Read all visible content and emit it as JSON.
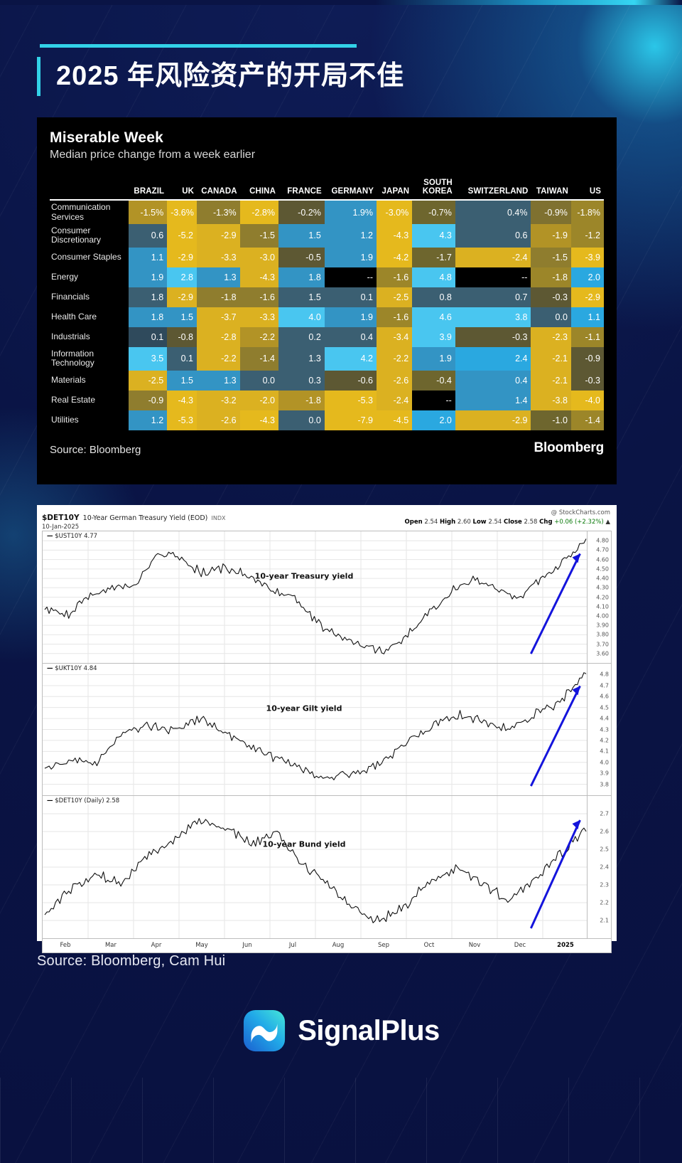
{
  "header": {
    "title": "2025 年风险资产的开局不佳"
  },
  "bloomberg": {
    "title": "Miserable Week",
    "subtitle": "Median price change from a week earlier",
    "source": "Source: Bloomberg",
    "logo": "Bloomberg",
    "columns": [
      "BRAZIL",
      "UK",
      "CANADA",
      "CHINA",
      "FRANCE",
      "GERMANY",
      "JAPAN",
      "SOUTH KOREA",
      "SWITZERLAND",
      "TAIWAN",
      "US"
    ],
    "rows": [
      {
        "label": "Communication Services",
        "values": [
          "-1.5%",
          "-3.6%",
          "-1.3%",
          "-2.8%",
          "-0.2%",
          "1.9%",
          "-3.0%",
          "-0.7%",
          "0.4%",
          "-0.9%",
          "-1.8%"
        ],
        "colors": [
          "#b29326",
          "#e5b91d",
          "#8f7d2e",
          "#e5b91d",
          "#5d5833",
          "#3394c4",
          "#e5b91d",
          "#6e662e",
          "#3b5f72",
          "#7f7130",
          "#9c8629"
        ]
      },
      {
        "label": "Consumer Discretionary",
        "values": [
          "0.6",
          "-5.2",
          "-2.9",
          "-1.5",
          "1.5",
          "1.2",
          "-4.3",
          "4.3",
          "0.6",
          "-1.9",
          "-1.2"
        ],
        "colors": [
          "#3b5f72",
          "#e5b91d",
          "#dbb121",
          "#8f7d2e",
          "#3394c4",
          "#3394c4",
          "#e5b91d",
          "#49c6f0",
          "#3b5f72",
          "#b29326",
          "#9c8629"
        ]
      },
      {
        "label": "Consumer Staples",
        "values": [
          "1.1",
          "-2.9",
          "-3.3",
          "-3.0",
          "-0.5",
          "1.9",
          "-4.2",
          "-1.7",
          "-2.4",
          "-1.5",
          "-3.9"
        ],
        "colors": [
          "#3394c4",
          "#e5b91d",
          "#dbb121",
          "#dbb121",
          "#5d5833",
          "#3394c4",
          "#e5b91d",
          "#6e662e",
          "#dbb121",
          "#8f7d2e",
          "#e5b91d"
        ]
      },
      {
        "label": "Energy",
        "values": [
          "1.9",
          "2.8",
          "1.3",
          "-4.3",
          "1.8",
          "--",
          "-1.6",
          "4.8",
          "--",
          "-1.8",
          "2.0"
        ],
        "colors": [
          "#3394c4",
          "#49c6f0",
          "#3394c4",
          "#dbb121",
          "#3394c4",
          "#000000",
          "#9c8629",
          "#49c6f0",
          "#000000",
          "#9c8629",
          "#2aa8e0"
        ]
      },
      {
        "label": "Financials",
        "values": [
          "1.8",
          "-2.9",
          "-1.8",
          "-1.6",
          "1.5",
          "0.1",
          "-2.5",
          "0.8",
          "0.7",
          "-0.3",
          "-2.9"
        ],
        "colors": [
          "#3b5f72",
          "#dbb121",
          "#8f7d2e",
          "#8f7d2e",
          "#3b5f72",
          "#3b5f72",
          "#dbb121",
          "#3b5f72",
          "#3b5f72",
          "#5d5833",
          "#e5b91d"
        ]
      },
      {
        "label": "Health Care",
        "values": [
          "1.8",
          "1.5",
          "-3.7",
          "-3.3",
          "4.0",
          "1.9",
          "-1.6",
          "4.6",
          "3.8",
          "0.0",
          "1.1"
        ],
        "colors": [
          "#3394c4",
          "#3394c4",
          "#dbb121",
          "#dbb121",
          "#49c6f0",
          "#3394c4",
          "#9c8629",
          "#49c6f0",
          "#49c6f0",
          "#3b5f72",
          "#2aa8e0"
        ]
      },
      {
        "label": "Industrials",
        "values": [
          "0.1",
          "-0.8",
          "-2.8",
          "-2.2",
          "0.2",
          "0.4",
          "-3.4",
          "3.9",
          "-0.3",
          "-2.3",
          "-1.1"
        ],
        "colors": [
          "#2f4a5c",
          "#5d5833",
          "#dbb121",
          "#b29326",
          "#3b5f72",
          "#3b5f72",
          "#dbb121",
          "#49c6f0",
          "#5d5833",
          "#dbb121",
          "#9c8629"
        ]
      },
      {
        "label": "Information Technology",
        "values": [
          "3.5",
          "0.1",
          "-2.2",
          "-1.4",
          "1.3",
          "4.2",
          "-2.2",
          "1.9",
          "2.4",
          "-2.1",
          "-0.9"
        ],
        "colors": [
          "#49c6f0",
          "#3b5f72",
          "#dbb121",
          "#8f7d2e",
          "#3b5f72",
          "#49c6f0",
          "#dbb121",
          "#3394c4",
          "#2aa8e0",
          "#dbb121",
          "#5d5833"
        ]
      },
      {
        "label": "Materials",
        "values": [
          "-2.5",
          "1.5",
          "1.3",
          "0.0",
          "0.3",
          "-0.6",
          "-2.6",
          "-0.4",
          "0.4",
          "-2.1",
          "-0.3"
        ],
        "colors": [
          "#dbb121",
          "#3394c4",
          "#3394c4",
          "#3b5f72",
          "#3b5f72",
          "#5d5833",
          "#dbb121",
          "#6e662e",
          "#3394c4",
          "#dbb121",
          "#5d5833"
        ]
      },
      {
        "label": "Real Estate",
        "values": [
          "-0.9",
          "-4.3",
          "-3.2",
          "-2.0",
          "-1.8",
          "-5.3",
          "-2.4",
          "--",
          "1.4",
          "-3.8",
          "-4.0"
        ],
        "colors": [
          "#8f7d2e",
          "#e5b91d",
          "#dbb121",
          "#dbb121",
          "#b29326",
          "#e5b91d",
          "#dbb121",
          "#000000",
          "#3394c4",
          "#dbb121",
          "#e5b91d"
        ]
      },
      {
        "label": "Utilities",
        "values": [
          "1.2",
          "-5.3",
          "-2.6",
          "-4.3",
          "0.0",
          "-7.9",
          "-4.5",
          "2.0",
          "-2.9",
          "-1.0",
          "-1.4"
        ],
        "colors": [
          "#3394c4",
          "#e5b91d",
          "#dbb121",
          "#e5b91d",
          "#3b5f72",
          "#e5b91d",
          "#e5b91d",
          "#2aa8e0",
          "#dbb121",
          "#6e662e",
          "#9c8629"
        ]
      }
    ]
  },
  "stockcharts": {
    "symbol": "$DET10Y",
    "description": "10-Year German Treasury Yield (EOD)",
    "index_tag": "INDX",
    "date": "10-Jan-2025",
    "brand": "@ StockCharts.com",
    "quote": {
      "open_label": "Open",
      "open": "2.54",
      "high_label": "High",
      "high": "2.60",
      "low_label": "Low",
      "low": "2.54",
      "close_label": "Close",
      "close": "2.58",
      "chg_label": "Chg",
      "chg": "+0.06 (+2.32%)"
    },
    "x_ticks": [
      "Feb",
      "Mar",
      "Apr",
      "May",
      "Jun",
      "Jul",
      "Aug",
      "Sep",
      "Oct",
      "Nov",
      "Dec",
      "2025"
    ],
    "panels": [
      {
        "legend": "$UST10Y 4.77",
        "title": "10-year Treasury yield",
        "y_ticks": [
          "4.80",
          "4.70",
          "4.60",
          "4.50",
          "4.40",
          "4.30",
          "4.20",
          "4.10",
          "4.00",
          "3.90",
          "3.80",
          "3.70",
          "3.60"
        ]
      },
      {
        "legend": "$UKT10Y 4.84",
        "title": "10-year Gilt yield",
        "y_ticks": [
          "4.8",
          "4.7",
          "4.6",
          "4.5",
          "4.4",
          "4.3",
          "4.2",
          "4.1",
          "4.0",
          "3.9",
          "3.8"
        ]
      },
      {
        "legend": "$DET10Y (Daily) 2.58",
        "title": "10-year Bund yield",
        "y_ticks": [
          "2.7",
          "2.6",
          "2.5",
          "2.4",
          "2.3",
          "2.2",
          "2.1"
        ]
      }
    ]
  },
  "source_note": "Source: Bloomberg, Cam Hui",
  "brand": {
    "name": "SignalPlus"
  },
  "chart_data": [
    {
      "type": "line",
      "title": "10-year Treasury yield",
      "series_name": "$UST10Y",
      "last_value": 4.77,
      "ylabel": "",
      "xlabel": "",
      "ylim": [
        3.55,
        4.85
      ],
      "grid": true,
      "legend_position": "top-left",
      "x": [
        "Feb",
        "Mar",
        "Apr",
        "May",
        "Jun",
        "Jul",
        "Aug",
        "Sep",
        "Oct",
        "Nov",
        "Dec",
        "2025"
      ],
      "values": [
        4.1,
        4.02,
        4.22,
        4.3,
        4.32,
        4.65,
        4.6,
        4.45,
        4.5,
        4.42,
        4.28,
        4.2,
        3.95,
        3.8,
        3.72,
        3.65,
        3.78,
        4.05,
        4.25,
        4.4,
        4.28,
        4.2,
        4.38,
        4.57,
        4.77
      ]
    },
    {
      "type": "line",
      "title": "10-year Gilt yield",
      "series_name": "$UKT10Y",
      "last_value": 4.84,
      "ylabel": "",
      "xlabel": "",
      "ylim": [
        3.75,
        4.87
      ],
      "grid": true,
      "legend_position": "top-left",
      "x": [
        "Feb",
        "Mar",
        "Apr",
        "May",
        "Jun",
        "Jul",
        "Aug",
        "Sep",
        "Oct",
        "Nov",
        "Dec",
        "2025"
      ],
      "values": [
        3.95,
        4.05,
        4.0,
        4.28,
        4.35,
        4.3,
        4.4,
        4.28,
        4.15,
        4.05,
        3.95,
        3.88,
        3.92,
        4.0,
        4.18,
        4.35,
        4.45,
        4.38,
        4.3,
        4.45,
        4.55,
        4.84
      ]
    },
    {
      "type": "line",
      "title": "10-year Bund yield",
      "series_name": "$DET10Y",
      "last_value": 2.58,
      "ylabel": "",
      "xlabel": "",
      "ylim": [
        2.05,
        2.72
      ],
      "grid": true,
      "legend_position": "top-left",
      "x": [
        "Feb",
        "Mar",
        "Apr",
        "May",
        "Jun",
        "Jul",
        "Aug",
        "Sep",
        "Oct",
        "Nov",
        "Dec",
        "2025"
      ],
      "values": [
        2.15,
        2.28,
        2.35,
        2.3,
        2.45,
        2.52,
        2.62,
        2.58,
        2.5,
        2.55,
        2.4,
        2.3,
        2.18,
        2.12,
        2.2,
        2.32,
        2.38,
        2.3,
        2.22,
        2.32,
        2.45,
        2.58
      ]
    }
  ]
}
